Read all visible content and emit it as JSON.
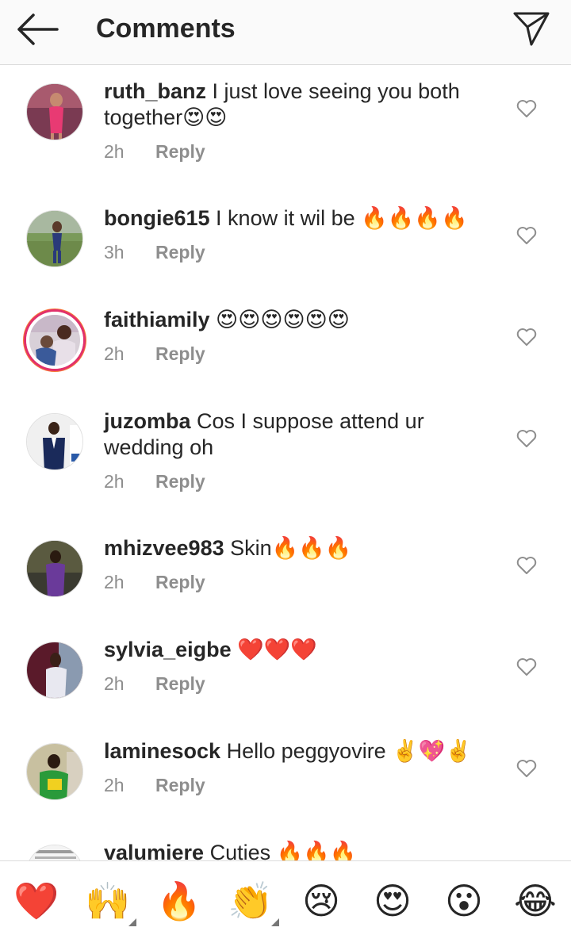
{
  "header": {
    "title": "Comments"
  },
  "comments": [
    {
      "username": "ruth_banz",
      "text": " I just love seeing you both together😍😍",
      "time": "2h",
      "reply": "Reply"
    },
    {
      "username": "bongie615",
      "text": " I know it wil be 🔥🔥🔥🔥",
      "time": "3h",
      "reply": "Reply"
    },
    {
      "username": "faithiamily",
      "text": " 😍😍😍😍😍😍",
      "time": "2h",
      "reply": "Reply"
    },
    {
      "username": "juzomba",
      "text": " Cos I suppose attend ur wedding oh",
      "time": "2h",
      "reply": "Reply"
    },
    {
      "username": "mhizvee983",
      "text": " Skin🔥🔥🔥",
      "time": "2h",
      "reply": "Reply"
    },
    {
      "username": "sylvia_eigbe",
      "text": " ❤️❤️❤️",
      "time": "2h",
      "reply": "Reply"
    },
    {
      "username": "laminesock",
      "text": " Hello peggyovire ✌️💖✌️",
      "time": "2h",
      "reply": "Reply"
    },
    {
      "username": "valumiere",
      "text": " Cuties 🔥🔥🔥",
      "time": "",
      "reply": ""
    }
  ],
  "emoji_bar": [
    "❤️",
    "🙌",
    "🔥",
    "👏",
    "😢",
    "😍",
    "😮",
    "😂"
  ],
  "colors": {
    "accent": "#0095f6",
    "story_ring": "#e1306c",
    "muted": "#8e8e8e"
  }
}
